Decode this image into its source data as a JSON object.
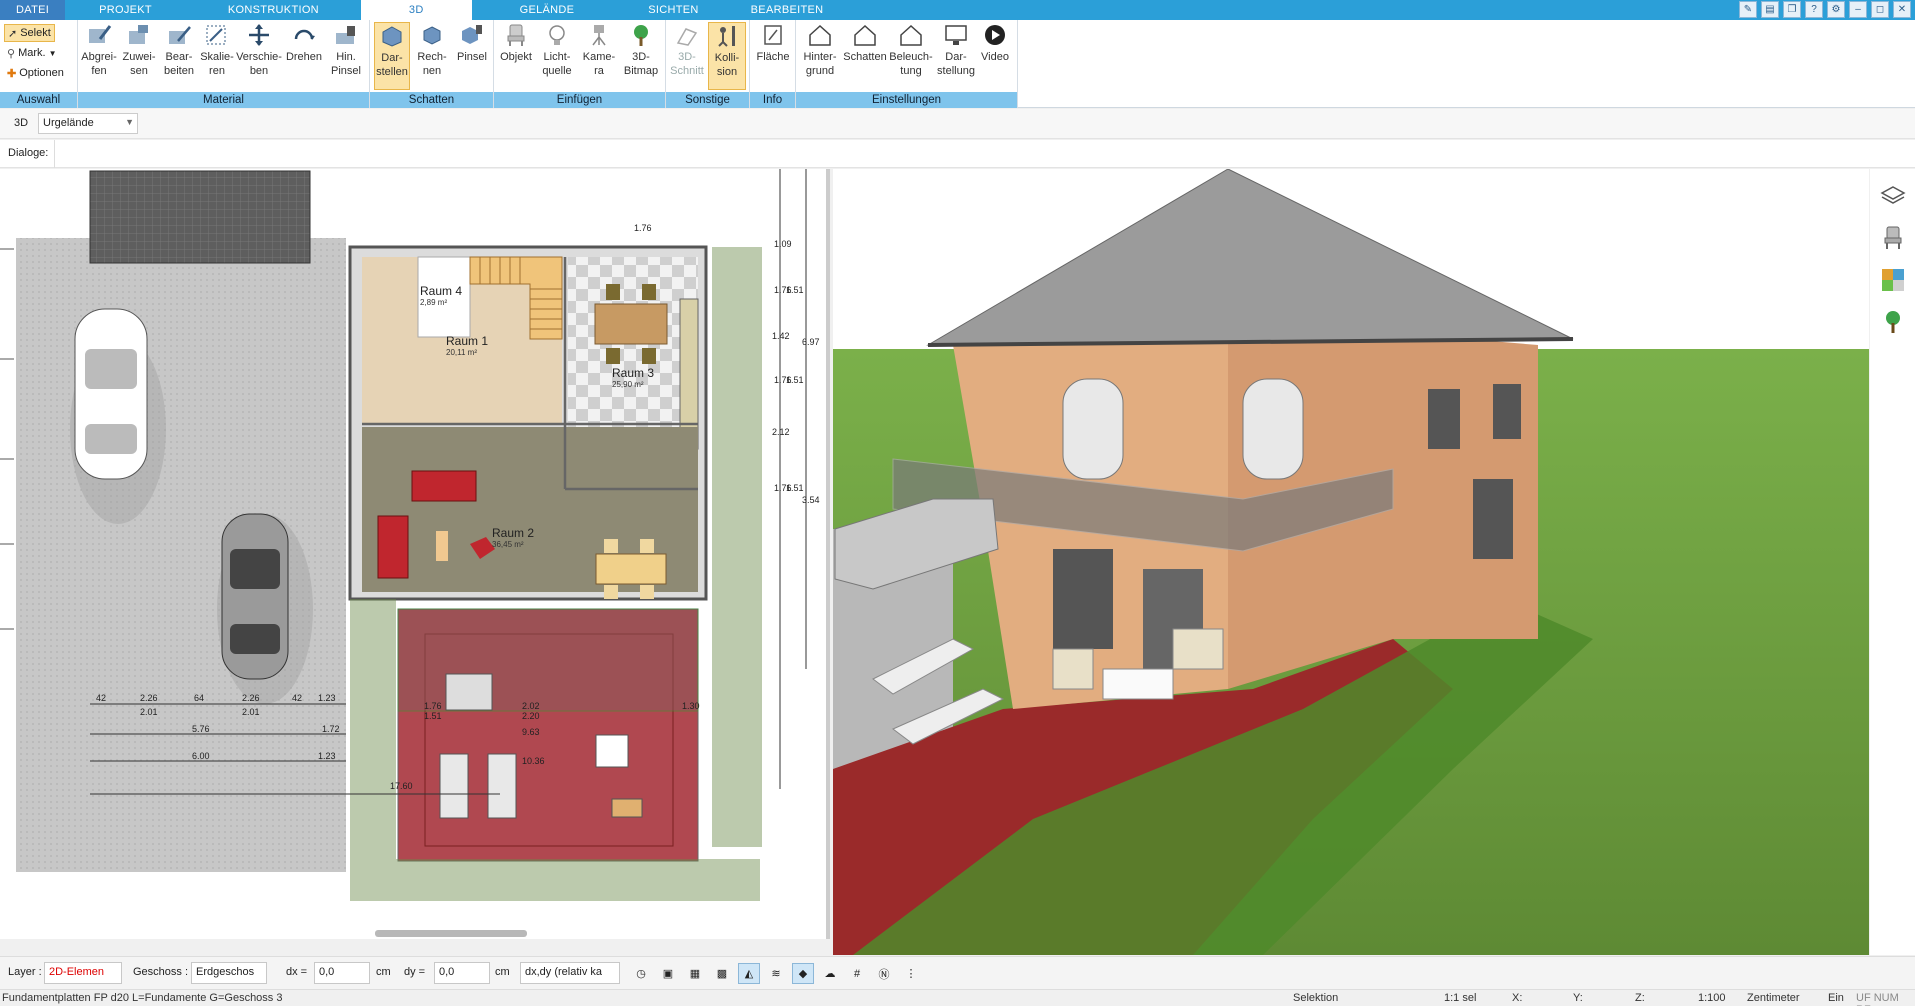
{
  "tabs": {
    "file": "DATEI",
    "items": [
      "PROJEKT",
      "KONSTRUKTION",
      "3D",
      "GELÄNDE",
      "SICHTEN",
      "BEARBEITEN"
    ],
    "active": "3D"
  },
  "ribbon": {
    "auswahl": {
      "label": "Auswahl",
      "selekt": "Selekt",
      "mark": "Mark.",
      "optionen": "Optionen"
    },
    "material": {
      "label": "Material",
      "abgreifen": "Abgrei-\nfen",
      "zuweisen": "Zuwei-\nsen",
      "bearbeiten": "Bear-\nbeiten",
      "skalieren": "Skalie-\nren",
      "verschieben": "Verschie-\nben",
      "drehen": "Drehen",
      "hinpinsel": "Hin.\nPinsel"
    },
    "schatten": {
      "label": "Schatten",
      "darstellen": "Dar-\nstellen",
      "rechnen": "Rech-\nnen",
      "pinsel": "Pinsel"
    },
    "einfuegen": {
      "label": "Einfügen",
      "objekt": "Objekt",
      "lichtquelle": "Licht-\nquelle",
      "kamera": "Kame-\nra",
      "bitmap": "3D-\nBitmap"
    },
    "sonstige": {
      "label": "Sonstige",
      "schnitt": "3D-\nSchnitt",
      "kollision": "Kolli-\nsion"
    },
    "info": {
      "label": "Info",
      "flaeche": "Fläche"
    },
    "einstellungen": {
      "label": "Einstellungen",
      "hintergrund": "Hinter-\ngrund",
      "schatten": "Schatten",
      "beleuchtung": "Beleuch-\ntung",
      "darstellung": "Dar-\nstellung",
      "video": "Video"
    }
  },
  "subbar": {
    "mode": "3D",
    "terrain": "Urgelände"
  },
  "dialogbar": {
    "label": "Dialoge:"
  },
  "plan": {
    "rooms": [
      {
        "name": "Raum 4",
        "area": "2,89 m²"
      },
      {
        "name": "Raum 1",
        "area": "20,11 m²"
      },
      {
        "name": "Raum 3",
        "area": "25,90 m²"
      },
      {
        "name": "Raum 2",
        "area": "36,45 m²"
      }
    ],
    "dims_top": [
      "1.76",
      "1.09",
      "1.76",
      "1.51",
      "1.42",
      "1.76",
      "1.51",
      "2.12",
      "1.76",
      "1.51"
    ],
    "dims_right": [
      "6.97",
      "3.54"
    ],
    "dims_bottom_row1": [
      "42",
      "2.26",
      "64",
      "2.26",
      "42",
      "1.23"
    ],
    "dims_bottom_row1b": [
      "2.01",
      "2.01"
    ],
    "dims_bottom_row2": [
      "5.76",
      "1.72"
    ],
    "dims_bottom_row3": [
      "6.00",
      "1.23"
    ],
    "dims_terrace": [
      "1.76",
      "2.02",
      "1.30",
      "1.51",
      "2.20",
      "9.63",
      "10.36",
      "17.60"
    ]
  },
  "bottombar": {
    "layer_label": "Layer :",
    "layer_value": "2D-Elemen",
    "geschoss_label": "Geschoss :",
    "geschoss_value": "Erdgeschos",
    "dx_label": "dx =",
    "dx_value": "0,0",
    "dx_unit": "cm",
    "dy_label": "dy =",
    "dy_value": "0,0",
    "dy_unit": "cm",
    "mode_value": "dx,dy (relativ ka"
  },
  "statusbar": {
    "info": "Fundamentplatten FP d20 L=Fundamente G=Geschoss 3",
    "selection": "Selektion",
    "count": "1:1 sel",
    "x": "X:",
    "y": "Y:",
    "z": "Z:",
    "scale": "1:100",
    "unit": "Zentimeter",
    "mode": "Ein",
    "flags": "UF  NUM  RF"
  },
  "colors": {
    "accent": "#2b9fd8",
    "group_label": "#7fc4ec",
    "selected": "#fbe3a7",
    "terrace": "#a03535",
    "grass": "#6a9a3a"
  }
}
